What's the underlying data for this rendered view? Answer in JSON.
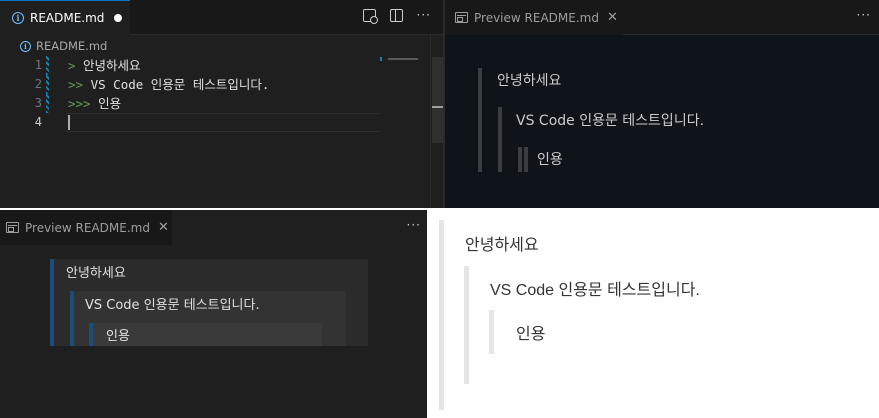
{
  "editor": {
    "tab_label": "README.md",
    "breadcrumb": "README.md",
    "lines": [
      {
        "num": "1",
        "prefix": ">",
        "text": " 안녕하세요"
      },
      {
        "num": "2",
        "prefix": ">>",
        "text": " VS Code 인용문 테스트입니다."
      },
      {
        "num": "3",
        "prefix": ">>>",
        "text": " 인용"
      },
      {
        "num": "4",
        "prefix": "",
        "text": ""
      }
    ],
    "icons": [
      "open-preview-icon",
      "split-editor-icon",
      "more-actions-icon"
    ]
  },
  "preview_dark": {
    "tab_label": "Preview README.md",
    "quote1": "안녕하세요",
    "quote2": "VS Code 인용문 테스트입니다.",
    "quote3": "인용"
  },
  "preview_dark2": {
    "tab_label": "Preview README.md",
    "quote1": "안녕하세요",
    "quote2": "VS Code 인용문 테스트입니다.",
    "quote3": "인용"
  },
  "preview_light": {
    "quote1": "안녕하세요",
    "quote2": "VS Code 인용문 테스트입니다.",
    "quote3": "인용"
  },
  "colors": {
    "editor_bg": "#1f1f1f",
    "accent": "#0078d4",
    "quote_border_dark": "#3a3d41",
    "quote_border_blue": "#1b4d7a",
    "quote_border_light": "#e5e5e5"
  }
}
